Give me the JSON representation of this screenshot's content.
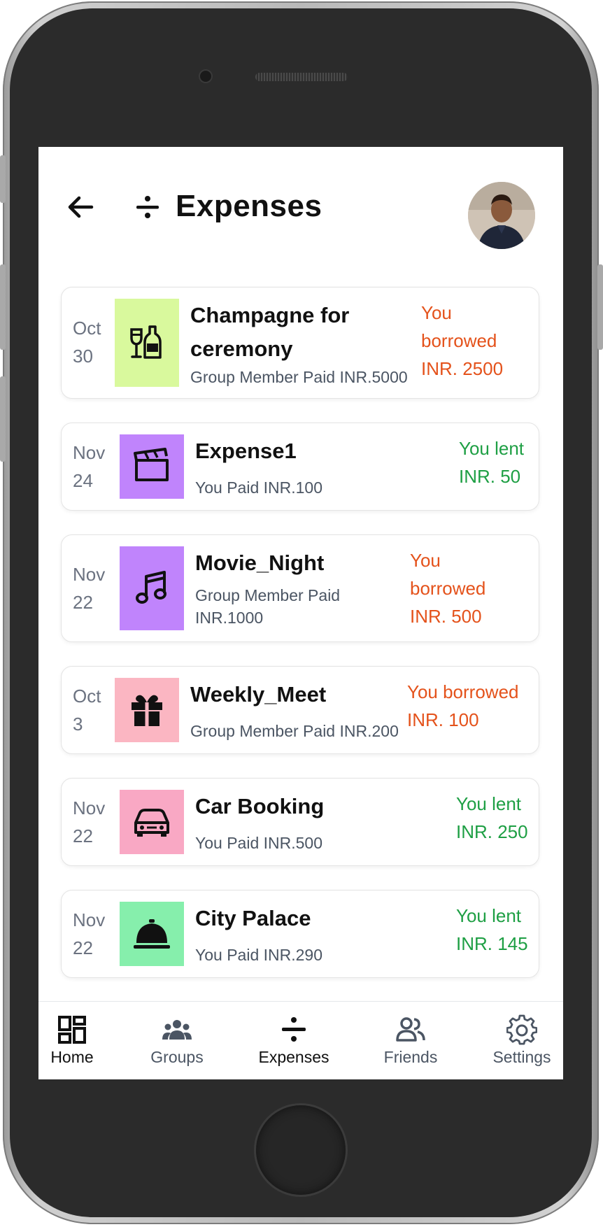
{
  "header": {
    "title": "Expenses"
  },
  "colors": {
    "borrowed": "#e4521b",
    "lent": "#1e9f44"
  },
  "expenses": [
    {
      "date_month": "Oct",
      "date_day": "30",
      "icon": "champagne-icon",
      "icon_bg": "#d9f99d",
      "name_line1": "Champagne for",
      "name_line2": "ceremony",
      "sub_line1": "Group Member Paid INR.5000",
      "sub_line2": "",
      "amount_line1": "You",
      "amount_line2": "borrowed",
      "amount_line3": "INR. 2500",
      "status": "borrowed"
    },
    {
      "date_month": "Nov",
      "date_day": "24",
      "icon": "clapperboard-icon",
      "icon_bg": "#c084fc",
      "name_line1": "Expense1",
      "name_line2": "",
      "sub_line1": "You Paid INR.100",
      "sub_line2": "",
      "amount_line1": "You lent",
      "amount_line2": "INR. 50",
      "amount_line3": "",
      "status": "lent"
    },
    {
      "date_month": "Nov",
      "date_day": "22",
      "icon": "music-note-icon",
      "icon_bg": "#c084fc",
      "name_line1": "Movie_Night",
      "name_line2": "",
      "sub_line1": "Group Member Paid",
      "sub_line2": "INR.1000",
      "amount_line1": "You",
      "amount_line2": "borrowed",
      "amount_line3": "INR. 500",
      "status": "borrowed"
    },
    {
      "date_month": "Oct",
      "date_day": "3",
      "icon": "gift-icon",
      "icon_bg": "#fbb6c2",
      "name_line1": "Weekly_Meet",
      "name_line2": "",
      "sub_line1": "Group Member Paid INR.200",
      "sub_line2": "",
      "amount_line1": "You borrowed",
      "amount_line2": "INR. 100",
      "amount_line3": "",
      "status": "borrowed"
    },
    {
      "date_month": "Nov",
      "date_day": "22",
      "icon": "car-icon",
      "icon_bg": "#f9a8c4",
      "name_line1": "Car Booking",
      "name_line2": "",
      "sub_line1": "You Paid INR.500",
      "sub_line2": "",
      "amount_line1": "You lent",
      "amount_line2": "INR. 250",
      "amount_line3": "",
      "status": "lent"
    },
    {
      "date_month": "Nov",
      "date_day": "22",
      "icon": "service-bell-icon",
      "icon_bg": "#86efac",
      "name_line1": "City Palace",
      "name_line2": "",
      "sub_line1": "You Paid INR.290",
      "sub_line2": "",
      "amount_line1": "You lent",
      "amount_line2": "INR. 145",
      "amount_line3": "",
      "status": "lent"
    }
  ],
  "nav": {
    "items": [
      {
        "label": "Home",
        "icon": "dashboard-icon",
        "active": true
      },
      {
        "label": "Groups",
        "icon": "groups-icon",
        "active": false
      },
      {
        "label": "Expenses",
        "icon": "divide-icon",
        "active": true
      },
      {
        "label": "Friends",
        "icon": "friends-icon",
        "active": false
      },
      {
        "label": "Settings",
        "icon": "gear-icon",
        "active": false
      }
    ]
  }
}
